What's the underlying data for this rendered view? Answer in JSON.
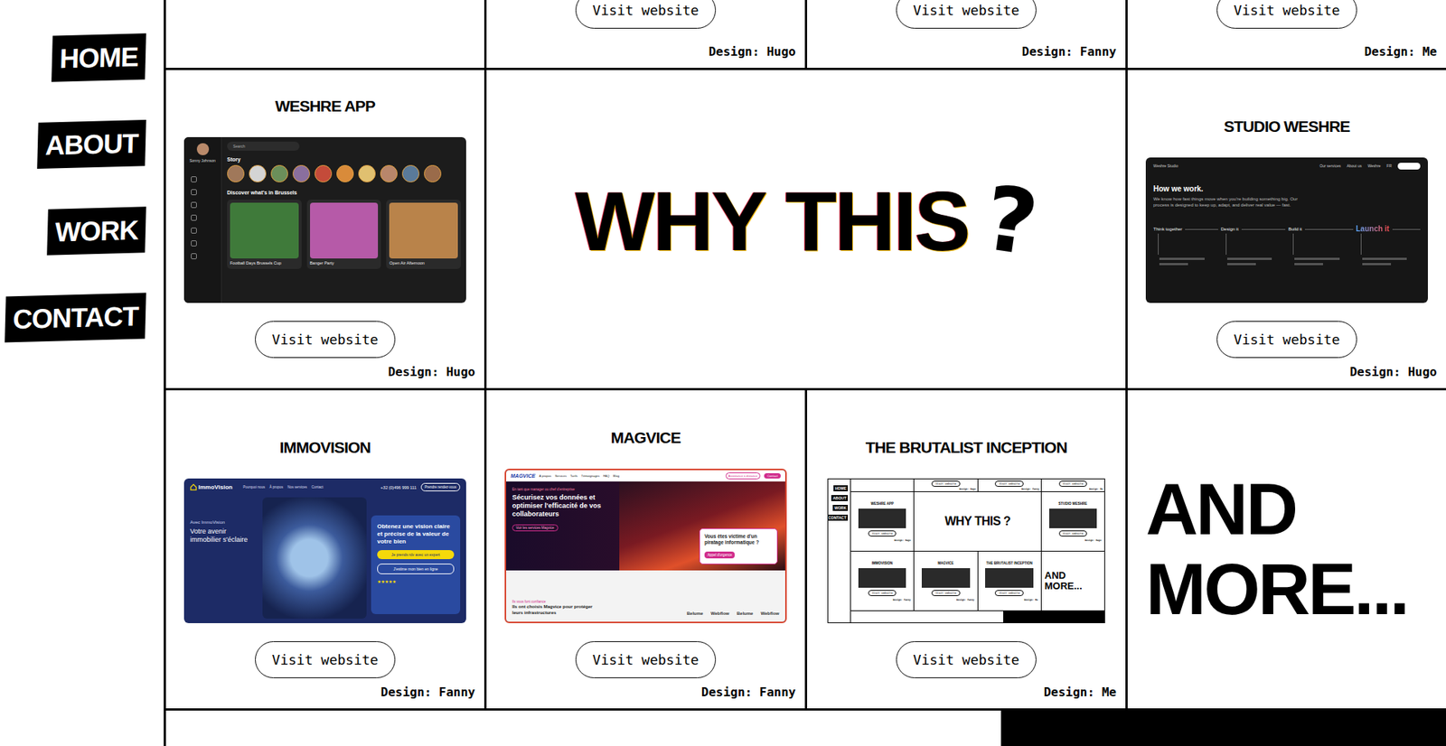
{
  "nav": [
    {
      "label": "HOME"
    },
    {
      "label": "ABOUT"
    },
    {
      "label": "WORK"
    },
    {
      "label": "CONTACT"
    }
  ],
  "top_row": [
    {
      "button": "Visit website",
      "design": "Design: Hugo"
    },
    {
      "button": "Visit website",
      "design": "Design: Fanny"
    },
    {
      "button": "Visit website",
      "design": "Design: Me"
    }
  ],
  "why": {
    "text": "WHY THIS",
    "mark": "?"
  },
  "more": {
    "line1": "AND",
    "line2": "MORE..."
  },
  "projects": [
    {
      "title": "WESHRE APP",
      "kind": "weshre-app",
      "button": "Visit website",
      "design": "Design: Hugo",
      "preview": {
        "user": "Sonny Johnson",
        "search": "Search",
        "story_title": "Story",
        "stories": [
          {
            "color": "#a0785a"
          },
          {
            "color": "#d4d4d4"
          },
          {
            "color": "#6b8f5a"
          },
          {
            "color": "#8a6f9e"
          },
          {
            "color": "#c44b3a"
          },
          {
            "color": "#d98b3a"
          },
          {
            "color": "#e0c070"
          },
          {
            "color": "#b8866b"
          },
          {
            "color": "#5a7a9a"
          },
          {
            "color": "#9a6b4a"
          }
        ],
        "section": "Discover what's in Brussels",
        "events": [
          {
            "title": "Football Days Brussels Cup",
            "color": "#3f7a3a"
          },
          {
            "title": "Banger Party",
            "color": "#b65aa8"
          },
          {
            "title": "Open Air Afternoon",
            "color": "#b9834a"
          }
        ]
      }
    },
    {
      "title": "STUDIO WESHRE",
      "kind": "studio",
      "button": "Visit website",
      "design": "Design: Hugo",
      "preview": {
        "brand": "Weshre Studio",
        "links": [
          "Our services",
          "About us",
          "Weshre",
          "FR"
        ],
        "heading": "How we work.",
        "text": "We know how fast things move when you're building something big. Our process is designed to keep up, adapt, and deliver real value — fast.",
        "steps": [
          {
            "label": "Think together",
            "highlight": false
          },
          {
            "label": "Design it",
            "highlight": false
          },
          {
            "label": "Build it",
            "highlight": false
          },
          {
            "label": "Launch it",
            "highlight": true
          }
        ]
      }
    },
    {
      "title": "IMMOVISION",
      "kind": "immovision",
      "button": "Visit website",
      "design": "Design: Fanny",
      "preview": {
        "brand": "ImmoVision",
        "links": [
          "Pourquoi nous",
          "À propos",
          "Nos services",
          "Contact"
        ],
        "phone": "+32 (0)496 999 111",
        "cta": "Prendre rendez-vous",
        "kicker": "Avec ImmoVision",
        "heading": "Votre avenir immobilier s'éclaire",
        "panel_heading": "Obtenez une vision claire et précise de la valeur de votre bien",
        "primary": "Je prends rdv avec un expert",
        "secondary": "J'estime mon bien en ligne",
        "rating": "★★★★★"
      }
    },
    {
      "title": "MAGVICE",
      "kind": "magvice",
      "button": "Visit website",
      "design": "Design: Fanny",
      "preview": {
        "brand": "MAGVICE",
        "links": [
          "À propos",
          "Services",
          "Tarifs",
          "Témoignages",
          "FAQ",
          "Blog"
        ],
        "assist": "Assistance à distance",
        "contact": "Contact",
        "kicker": "En tant que manager ou chef d'entreprise",
        "heading": "Sécurisez vos données et optimiser l'efficacité de vos collaborateurs",
        "cta": "Voir les services Magvice",
        "popup": "Vous êtes victime d'un piratage informatique ?",
        "popup_button": "Appel d'urgence",
        "trust_kicker": "Ils vous font confiance",
        "trust": "Ils ont choisis Magvice pour protéger leurs infrastructures",
        "logos": [
          "Belume",
          "Webflow",
          "Belume",
          "Webflow"
        ]
      }
    },
    {
      "title": "THE BRUTALIST INCEPTION",
      "kind": "brutalist",
      "button": "Visit website",
      "design": "Design: Me",
      "preview": {
        "nav": [
          "HOME",
          "ABOUT",
          "WORK",
          "CONTACT"
        ],
        "top": [
          {
            "button": "Visit website",
            "design": "Design: Hugo"
          },
          {
            "button": "Visit website",
            "design": "Design: Fanny"
          },
          {
            "button": "Visit website",
            "design": "Design: Me"
          }
        ],
        "cells": [
          {
            "kind": "card",
            "title": "WESHRE APP",
            "button": "Visit website",
            "design": "Design: Hugo"
          },
          {
            "kind": "big",
            "title": "WHY THIS ?"
          },
          {
            "kind": "card",
            "title": "STUDIO WESHRE",
            "button": "Visit website",
            "design": "Design: Hugo"
          },
          {
            "kind": "card",
            "title": "IMMOVISION",
            "button": "Visit website",
            "design": "Design: Fanny"
          },
          {
            "kind": "card",
            "title": "MAGVICE",
            "button": "Visit website",
            "design": "Design: Fanny"
          },
          {
            "kind": "card",
            "title": "THE BRUTALIST INCEPTION",
            "button": "Visit website",
            "design": "Design: Me"
          },
          {
            "kind": "more",
            "title": "AND MORE..."
          }
        ]
      }
    }
  ]
}
